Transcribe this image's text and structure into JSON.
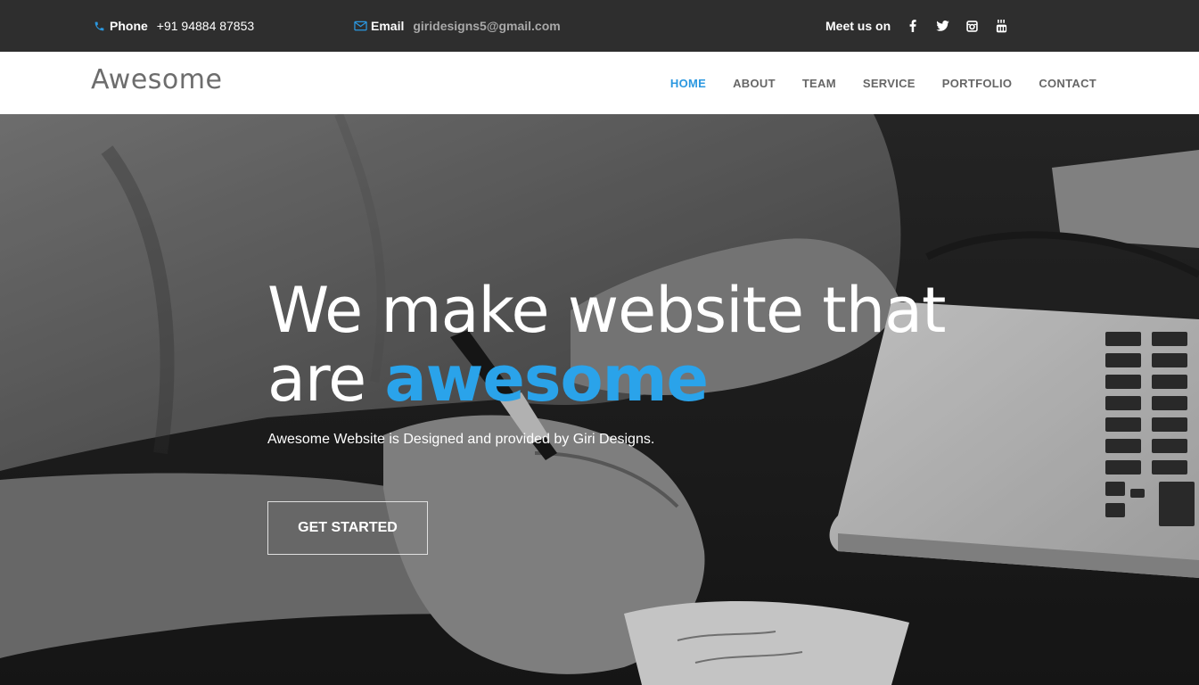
{
  "topbar": {
    "phone_label": "Phone",
    "phone_value": "+91 94884 87853",
    "email_label": "Email",
    "email_value": "giridesigns5@gmail.com",
    "social_label": "Meet us on",
    "social_icons": [
      "facebook-icon",
      "twitter-icon",
      "instagram-icon",
      "youtube-icon"
    ],
    "colors": {
      "background": "#2e2e2e",
      "icon_accent": "#2b98e0"
    }
  },
  "navbar": {
    "brand": "Awesome",
    "items": [
      "HOME",
      "ABOUT",
      "TEAM",
      "SERVICE",
      "PORTFOLIO",
      "CONTACT"
    ],
    "active": "HOME",
    "colors": {
      "active": "#2b98e0",
      "default": "#666666"
    }
  },
  "hero": {
    "title_line1": "We make website that",
    "title_line2_prefix": "are",
    "title_accent": "awesome",
    "subtitle": "Awesome Website is Designed and provided by Giri Designs.",
    "cta_label": "GET STARTED",
    "colors": {
      "accent": "#2aa3ea"
    }
  }
}
